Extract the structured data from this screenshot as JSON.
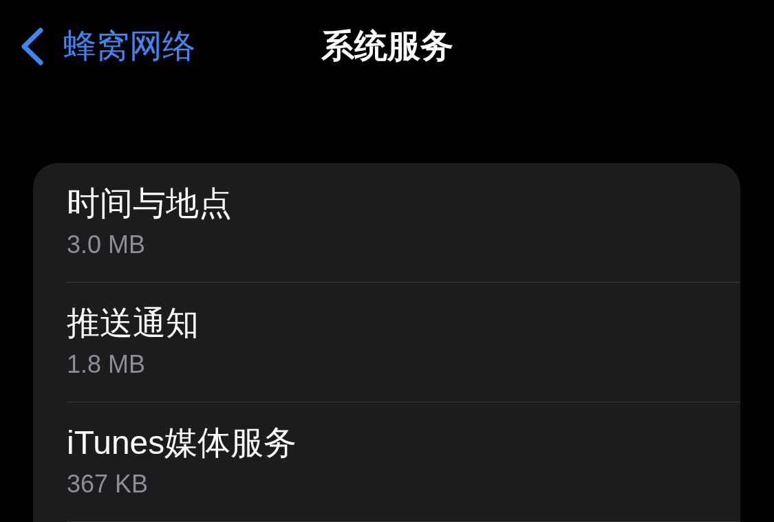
{
  "nav": {
    "back_label": "蜂窝网络",
    "title": "系统服务"
  },
  "services": [
    {
      "name": "时间与地点",
      "usage": "3.0 MB"
    },
    {
      "name": "推送通知",
      "usage": "1.8 MB"
    },
    {
      "name": "iTunes媒体服务",
      "usage": "367 KB"
    }
  ]
}
